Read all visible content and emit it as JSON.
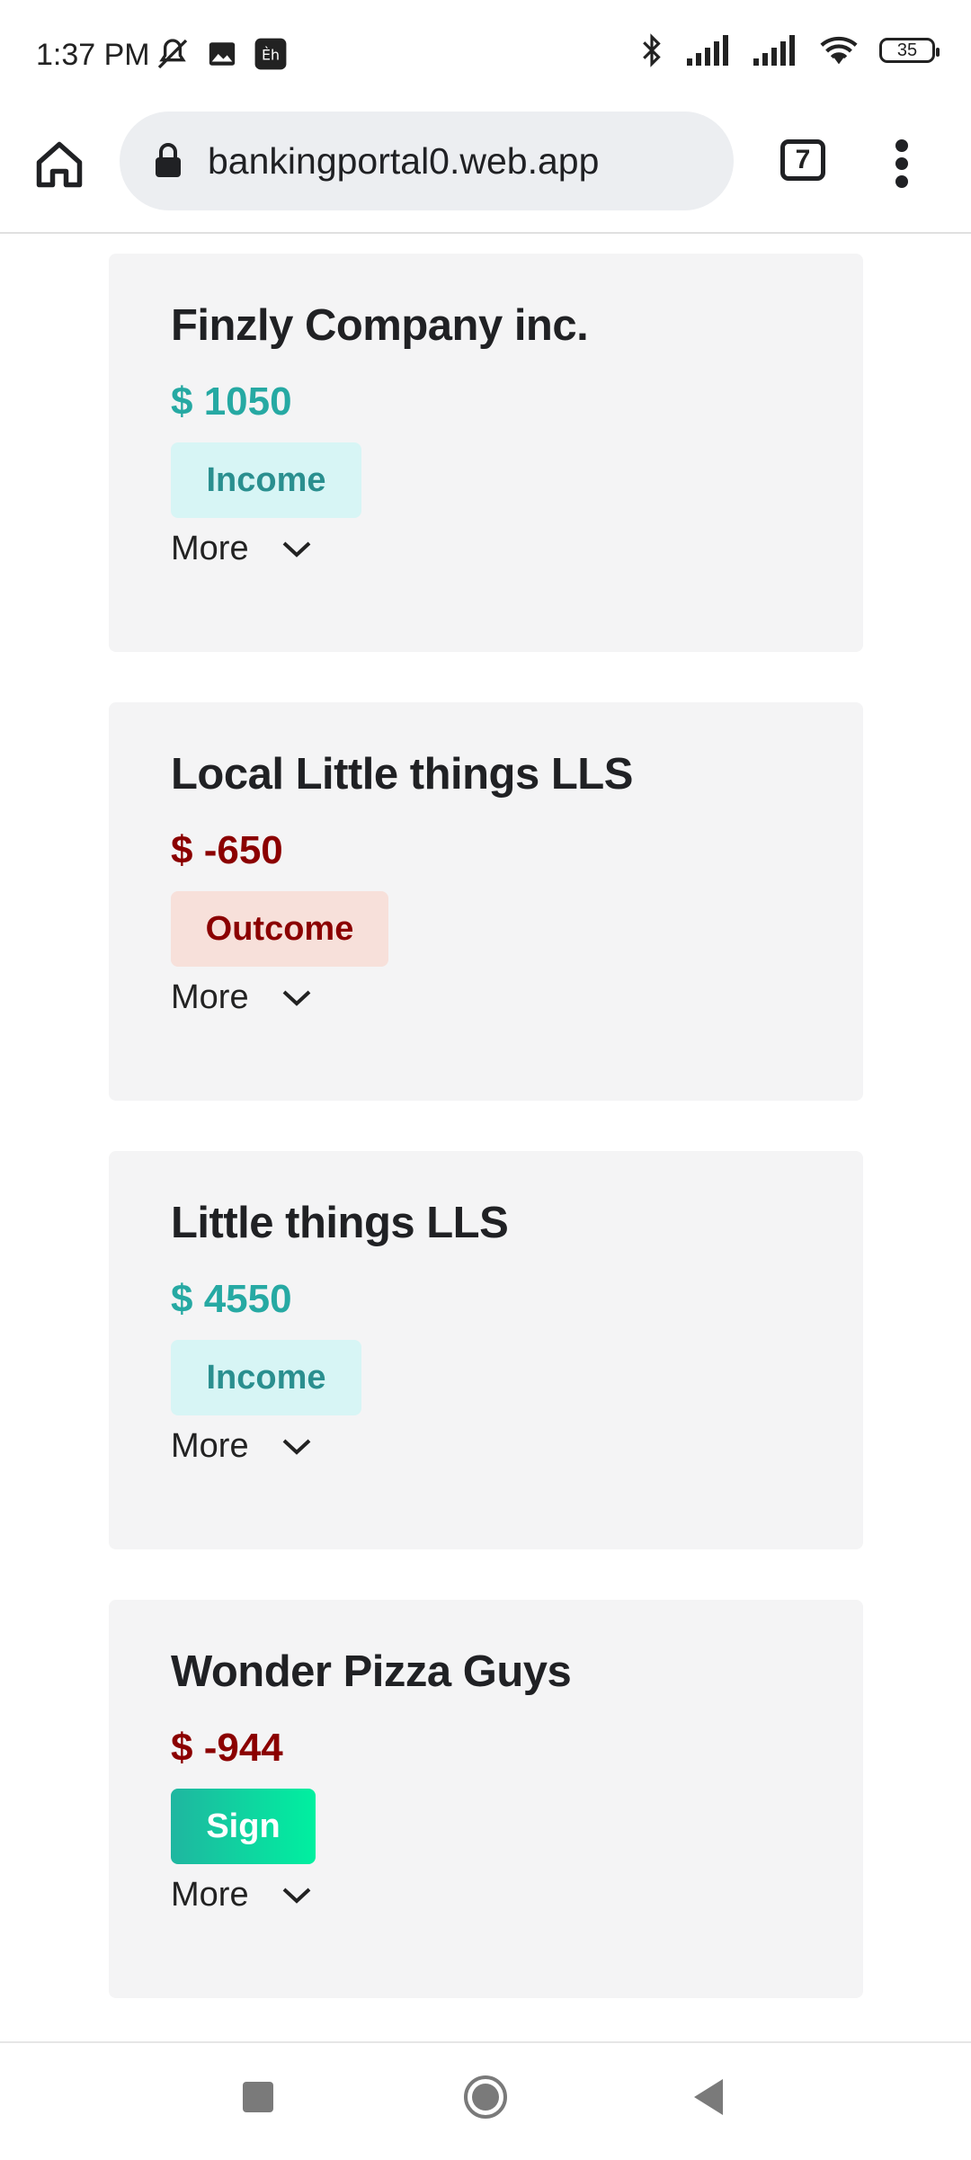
{
  "status_bar": {
    "time": "1:37 PM",
    "battery": "35",
    "icons": [
      "mute-icon",
      "image-icon",
      "app-icon",
      "bluetooth-icon",
      "signal-icon",
      "signal-icon",
      "wifi-icon",
      "battery-icon"
    ]
  },
  "browser": {
    "url": "bankingportal0.web.app",
    "tab_count": "7"
  },
  "transactions": [
    {
      "name": "Finzly Company inc.",
      "amount": "$ 1050",
      "badge": "Income",
      "more": "More"
    },
    {
      "name": "Local Little things LLS",
      "amount": "$ -650",
      "badge": "Outcome",
      "more": "More"
    },
    {
      "name": "Little things LLS",
      "amount": "$ 4550",
      "badge": "Income",
      "more": "More"
    },
    {
      "name": "Wonder Pizza Guys",
      "amount": "$ -944",
      "badge": "Sign",
      "more": "More"
    }
  ],
  "colors": {
    "income": "#26a9a3",
    "outcome": "#8b0000",
    "card_bg": "#f4f4f5"
  }
}
